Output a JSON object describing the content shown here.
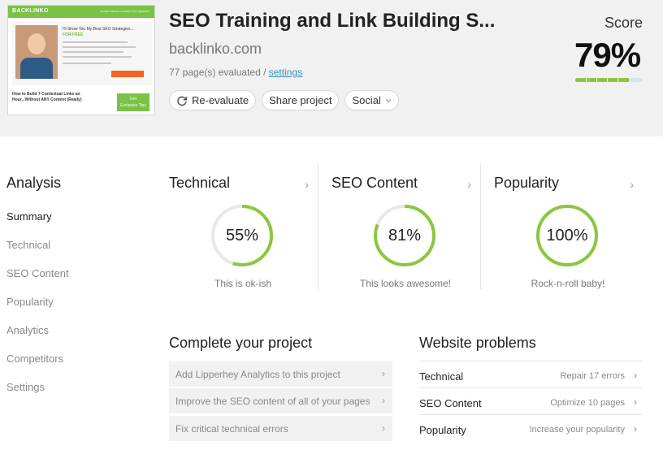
{
  "header": {
    "site_title": "SEO Training and Link Building S...",
    "domain": "backlinko.com",
    "pages_evaluated": "77 page(s) evaluated / ",
    "settings_link": "settings",
    "buttons": {
      "reevaluate": "Re-evaluate",
      "share": "Share project",
      "social": "Social"
    },
    "score_label": "Score",
    "score_value": "79%",
    "score_fraction": 0.79
  },
  "thumbnail": {
    "logo": "BACKLINKO",
    "nav_links": "Home  About  Contact  Get Updates",
    "hero_line1": "I'll Show You My Best SEO Strategies...",
    "hero_line2": "FOR FREE",
    "post_title_1": "How to Build 7 Contextual Links an",
    "post_title_2": "Hour...Without ANY Content (Really)",
    "tip_1": "Get",
    "tip_2": "Exclusive Tips"
  },
  "sidebar": {
    "title": "Analysis",
    "items": [
      {
        "label": "Summary",
        "active": true
      },
      {
        "label": "Technical",
        "active": false
      },
      {
        "label": "SEO Content",
        "active": false
      },
      {
        "label": "Popularity",
        "active": false
      },
      {
        "label": "Analytics",
        "active": false
      },
      {
        "label": "Competitors",
        "active": false
      },
      {
        "label": "Settings",
        "active": false
      }
    ]
  },
  "metrics": [
    {
      "title": "Technical",
      "value_label": "55%",
      "value": 55,
      "caption": "This is ok-ish"
    },
    {
      "title": "SEO Content",
      "value_label": "81%",
      "value": 81,
      "caption": "This looks awesome!"
    },
    {
      "title": "Popularity",
      "value_label": "100%",
      "value": 100,
      "caption": "Rock-n-roll baby!"
    }
  ],
  "complete_project": {
    "title": "Complete your project",
    "tasks": [
      "Add Lipperhey Analytics to this project",
      "Improve the SEO content of all of your pages",
      "Fix critical technical errors"
    ]
  },
  "website_problems": {
    "title": "Website problems",
    "rows": [
      {
        "name": "Technical",
        "action": "Repair 17 errors"
      },
      {
        "name": "SEO Content",
        "action": "Optimize 10 pages"
      },
      {
        "name": "Popularity",
        "action": "Increase your popularity"
      }
    ]
  },
  "colors": {
    "accent_green": "#8cc63f",
    "track_gray": "#e8e8ea",
    "link_blue": "#3a8dc5",
    "header_bg": "#f1f1f2"
  },
  "icons": {
    "reevaluate": "refresh-icon",
    "social": "chevron-down-icon",
    "card_chevron": "chevron-right-icon"
  }
}
